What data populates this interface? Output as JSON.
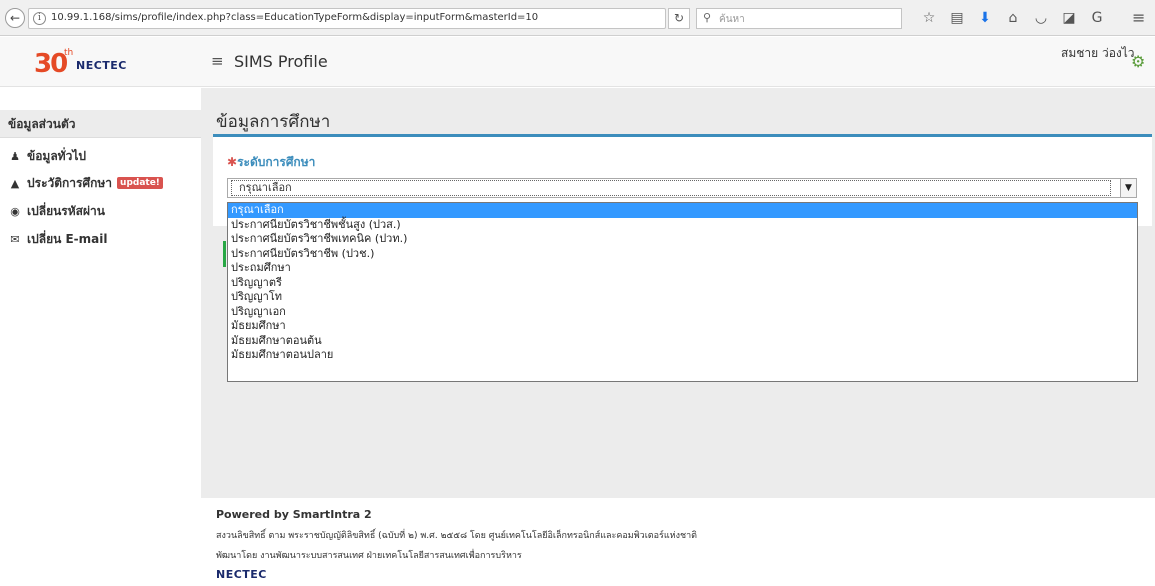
{
  "browser": {
    "url": "10.99.1.168/sims/profile/index.php?class=EducationTypeForm&display=inputForm&masterId=10",
    "search_placeholder": "ค้นหา"
  },
  "header": {
    "logo_number": "30",
    "logo_th": "th",
    "logo_brand": "NECTEC",
    "title": "SIMS Profile",
    "user_name": "สมชาย ว่องไว"
  },
  "sidebar": {
    "heading": "ข้อมูลส่วนตัว",
    "items": [
      {
        "label": "ข้อมูลทั่วไป",
        "icon": "user-icon"
      },
      {
        "label": "ประวัติการศึกษา",
        "icon": "graduation-cap-icon",
        "badge": "update!"
      },
      {
        "label": "เปลี่ยนรหัสผ่าน",
        "icon": "lock-icon"
      },
      {
        "label": "เปลี่ยน E-mail",
        "icon": "envelope-icon"
      }
    ]
  },
  "main": {
    "page_title": "ข้อมูลการศึกษา",
    "field_required_mark": "✱",
    "field_label": "ระดับการศึกษา",
    "select_value": "กรุณาเลือก",
    "options": [
      "กรุณาเลือก",
      "ประกาศนียบัตรวิชาชีพชั้นสูง (ปวส.)",
      "ประกาศนียบัตรวิชาชีพเทคนิค (ปวท.)",
      "ประกาศนียบัตรวิชาชีพ (ปวช.)",
      "ประถมศึกษา",
      "ปริญญาตรี",
      "ปริญญาโท",
      "ปริญญาเอก",
      "มัธยมศึกษา",
      "มัธยมศึกษาตอนต้น",
      "มัธยมศึกษาตอนปลาย"
    ]
  },
  "footer": {
    "powered": "Powered by SmartIntra 2",
    "copyright": "สงวนลิขสิทธิ์ ตาม พระราชบัญญัติลิขสิทธิ์ (ฉบับที่ ๒) พ.ศ. ๒๕๕๘ โดย ศูนย์เทคโนโลยีอิเล็กทรอนิกส์และคอมพิวเตอร์แห่งชาติ",
    "developed": "พัฒนาโดย งานพัฒนาระบบสารสนเทศ ฝ่ายเทคโนโลยีสารสนเทศเพื่อการบริหาร",
    "logo": "NECTEC"
  }
}
